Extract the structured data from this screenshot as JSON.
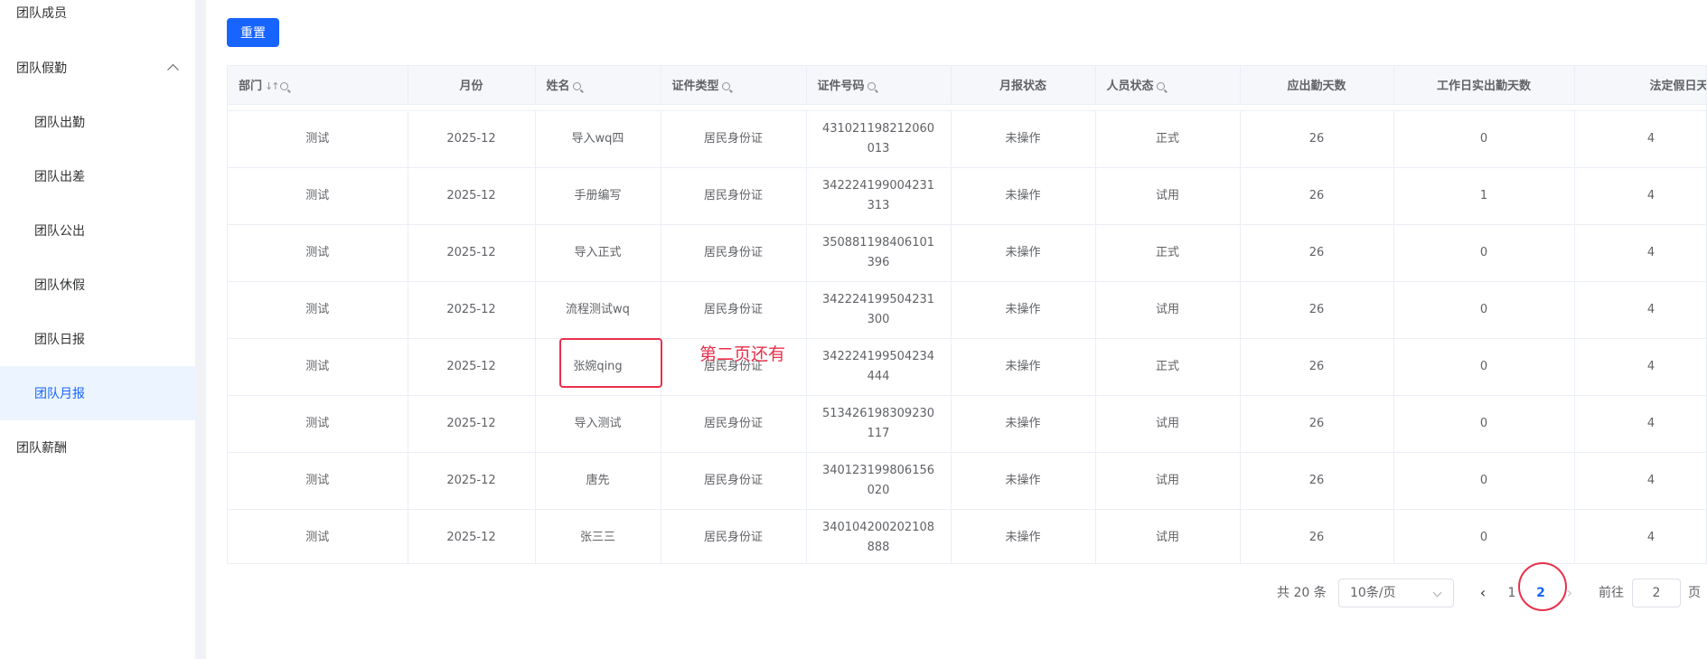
{
  "sidebar": {
    "items": [
      {
        "label": "团队成员"
      },
      {
        "label": "团队假勤"
      },
      {
        "label": "团队出勤"
      },
      {
        "label": "团队出差"
      },
      {
        "label": "团队公出"
      },
      {
        "label": "团队休假"
      },
      {
        "label": "团队日报"
      },
      {
        "label": "团队月报"
      },
      {
        "label": "团队薪酬"
      }
    ],
    "accent_color": "#1764ff"
  },
  "toolbar": {
    "reset_label": "重置"
  },
  "table": {
    "headers": [
      "部门",
      "月份",
      "姓名",
      "证件类型",
      "证件号码",
      "月报状态",
      "人员状态",
      "应出勤天数",
      "工作日实出勤天数",
      "法定假日天数"
    ],
    "rows": [
      [
        "测试",
        "2025-12",
        "导入wq四",
        "居民身份证",
        "431021198212060013",
        "未操作",
        "正式",
        "26",
        "0",
        "4"
      ],
      [
        "测试",
        "2025-12",
        "手册编写",
        "居民身份证",
        "342224199004231313",
        "未操作",
        "试用",
        "26",
        "1",
        "4"
      ],
      [
        "测试",
        "2025-12",
        "导入正式",
        "居民身份证",
        "350881198406101396",
        "未操作",
        "正式",
        "26",
        "0",
        "4"
      ],
      [
        "测试",
        "2025-12",
        "流程测试wq",
        "居民身份证",
        "342224199504231300",
        "未操作",
        "试用",
        "26",
        "0",
        "4"
      ],
      [
        "测试",
        "2025-12",
        "张婉qing",
        "居民身份证",
        "342224199504234444",
        "未操作",
        "正式",
        "26",
        "0",
        "4"
      ],
      [
        "测试",
        "2025-12",
        "导入测试",
        "居民身份证",
        "513426198309230117",
        "未操作",
        "试用",
        "26",
        "0",
        "4"
      ],
      [
        "测试",
        "2025-12",
        "唐先",
        "居民身份证",
        "340123199806156020",
        "未操作",
        "试用",
        "26",
        "0",
        "4"
      ],
      [
        "测试",
        "2025-12",
        "张三三",
        "居民身份证",
        "340104200202108888",
        "未操作",
        "试用",
        "26",
        "0",
        "4"
      ]
    ]
  },
  "annotation": {
    "text": "第二页还有",
    "color": "#e8304b"
  },
  "pagination": {
    "total": "共 20 条",
    "page_size": "10条/页",
    "pages": [
      "1",
      "2"
    ],
    "current_page": "2",
    "goto_label": "前往",
    "goto_value": "2",
    "page_suffix": "页"
  }
}
